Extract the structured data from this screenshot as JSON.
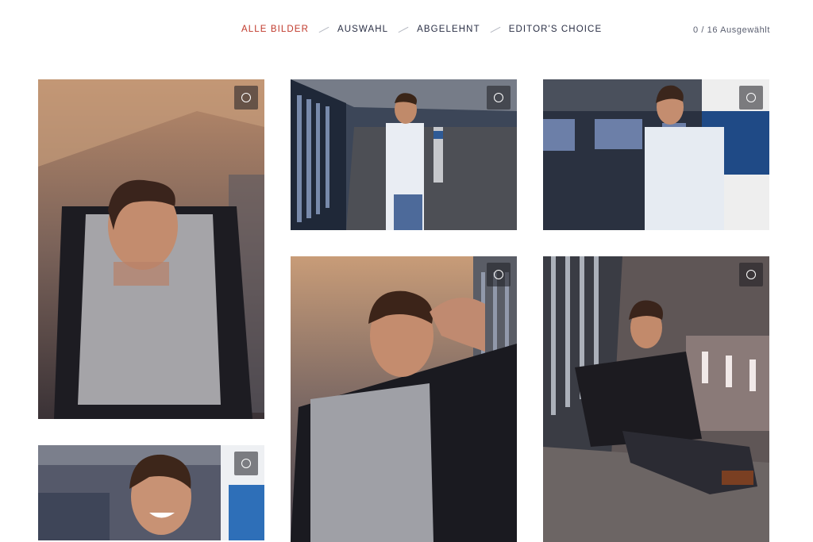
{
  "filters": [
    {
      "label": "ALLE BILDER",
      "active": true
    },
    {
      "label": "AUSWAHL",
      "active": false
    },
    {
      "label": "ABGELEHNT",
      "active": false
    },
    {
      "label": "EDITOR'S CHOICE",
      "active": false
    }
  ],
  "selection": {
    "counter": "0 / 16 Ausgewählt"
  },
  "photos": [
    {
      "subject": "man in grey sweater opening black leather jacket",
      "selected": false
    },
    {
      "subject": "man in white shirt in parking garage corridor",
      "selected": false
    },
    {
      "subject": "man in white shirt leaning against pillar",
      "selected": false
    },
    {
      "subject": "man touching forehead wearing leather jacket",
      "selected": false
    },
    {
      "subject": "man sitting on ledge in leather jacket",
      "selected": false
    },
    {
      "subject": "man smiling portrait",
      "selected": false
    }
  ]
}
